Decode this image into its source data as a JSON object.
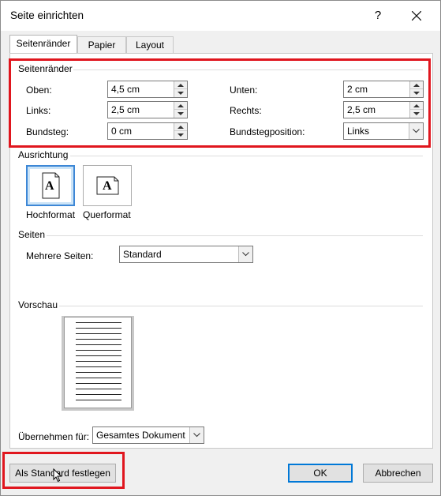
{
  "window": {
    "title": "Seite einrichten",
    "help_glyph": "?"
  },
  "tabs": [
    {
      "label": "Seitenränder",
      "active": true
    },
    {
      "label": "Papier",
      "active": false
    },
    {
      "label": "Layout",
      "active": false
    }
  ],
  "margins": {
    "section_label": "Seitenränder",
    "top": {
      "label": "Oben:",
      "value": "4,5 cm"
    },
    "bottom": {
      "label": "Unten:",
      "value": "2 cm"
    },
    "left": {
      "label": "Links:",
      "value": "2,5 cm"
    },
    "right": {
      "label": "Rechts:",
      "value": "2,5 cm"
    },
    "gutter": {
      "label": "Bundsteg:",
      "value": "0 cm"
    },
    "gutter_position": {
      "label": "Bundstegposition:",
      "value": "Links"
    }
  },
  "orientation": {
    "section_label": "Ausrichtung",
    "portrait_label": "Hochformat",
    "landscape_label": "Querformat",
    "icon_glyph": "A",
    "selected": "portrait"
  },
  "pages": {
    "section_label": "Seiten",
    "multiple_label": "Mehrere Seiten:",
    "multiple_value": "Standard"
  },
  "preview": {
    "section_label": "Vorschau"
  },
  "apply_to": {
    "label": "Übernehmen für:",
    "value": "Gesamtes Dokument"
  },
  "buttons": {
    "default_label": "Als Standard festlegen",
    "ok_label": "OK",
    "cancel_label": "Abbrechen"
  },
  "colors": {
    "highlight_frame": "#e0161e",
    "selection_blue": "#3d87d6",
    "dialog_bg": "#f0f0f0"
  }
}
